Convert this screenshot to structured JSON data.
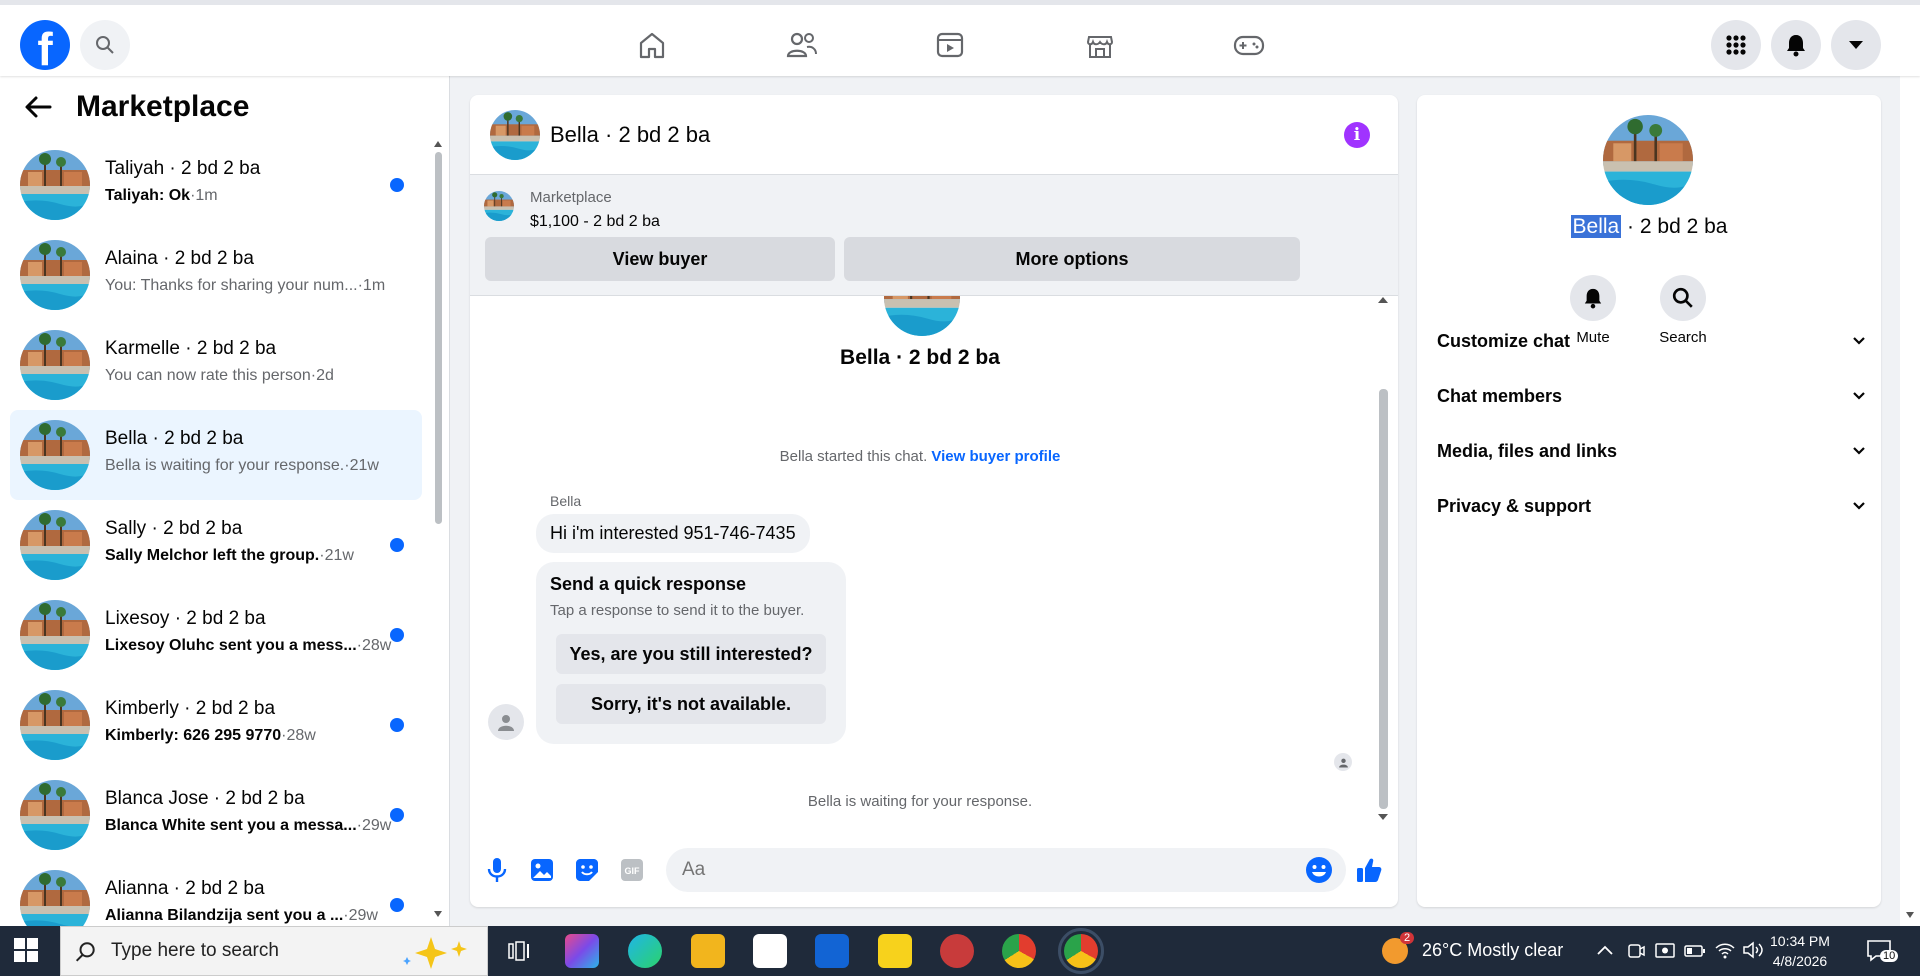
{
  "topbar": {
    "logo_letter": "f",
    "icons": [
      "search-icon",
      "home-icon",
      "friends-icon",
      "watch-icon",
      "marketplace-icon",
      "gaming-icon",
      "menu-grid-icon",
      "notifications-icon",
      "account-caret-icon"
    ]
  },
  "sidebar": {
    "title": "Marketplace",
    "conversations": [
      {
        "name": "Taliyah · 2 bd 2 ba",
        "preview": "Taliyah: Ok",
        "time": "·1m",
        "unread": true
      },
      {
        "name": "Alaina · 2 bd 2 ba",
        "preview": "You: Thanks for sharing your num...",
        "time": "·1m",
        "unread": false
      },
      {
        "name": "Karmelle · 2 bd 2 ba",
        "preview": "You can now rate this person",
        "time": "·2d",
        "unread": false
      },
      {
        "name": "Bella · 2 bd 2 ba",
        "preview": "Bella is waiting for your response.",
        "time": "·21w",
        "unread": false,
        "selected": true
      },
      {
        "name": "Sally · 2 bd 2 ba",
        "preview": "Sally Melchor left the group.",
        "time": "·21w",
        "unread": true
      },
      {
        "name": "Lixesoy · 2 bd 2 ba",
        "preview": "Lixesoy Oluhc sent you a mess...",
        "time": "·28w",
        "unread": true
      },
      {
        "name": "Kimberly · 2 bd 2 ba",
        "preview": "Kimberly: 626 295 9770",
        "time": "·28w",
        "unread": true
      },
      {
        "name": "Blanca Jose · 2 bd 2 ba",
        "preview": "Blanca White sent you a messa...",
        "time": "·29w",
        "unread": true
      },
      {
        "name": "Alianna · 2 bd 2 ba",
        "preview": "Alianna Bilandzija sent you a ...",
        "time": "·29w",
        "unread": true
      }
    ]
  },
  "chat": {
    "header_name": "Bella · 2 bd 2 ba",
    "marketplace_label": "Marketplace",
    "listing": "$1,100 - 2 bd 2 ba",
    "view_buyer": "View buyer",
    "more_options": "More options",
    "conv_title": "Bella · 2 bd 2 ba",
    "started_text": "Bella started this chat.",
    "view_profile": "View buyer profile",
    "sender": "Bella",
    "message": "Hi i'm interested 951-746-7435",
    "quick_title": "Send a quick response",
    "quick_sub": "Tap a response to send it to the buyer.",
    "quick_1": "Yes, are you still interested?",
    "quick_2": "Sorry, it's not available.",
    "waiting": "Bella is waiting for your response.",
    "input_placeholder": "Aa"
  },
  "details": {
    "name_highlight": "Bella",
    "name_rest": " · 2 bd 2 ba",
    "mute": "Mute",
    "search": "Search",
    "rows": [
      "Customize chat",
      "Chat members",
      "Media, files and links",
      "Privacy & support"
    ]
  },
  "taskbar": {
    "search_placeholder": "Type here to search",
    "weather": "26°C  Mostly clear",
    "weather_badge": "2",
    "time": "10:34 PM",
    "date": "4/8/2026",
    "notif_count": "10"
  },
  "colors": {
    "brand": "#0866ff",
    "unread_dot": "#0866ff",
    "info": "#a033ff",
    "selected": "#ebf5ff"
  }
}
